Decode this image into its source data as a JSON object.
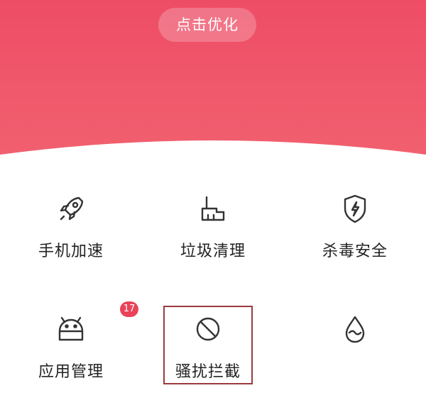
{
  "header": {
    "optimize_label": "点击优化",
    "color_top": "#ee4d66",
    "color_bottom": "#f1606f"
  },
  "tools": [
    {
      "label": "手机加速",
      "icon": "rocket-icon"
    },
    {
      "label": "垃圾清理",
      "icon": "broom-icon"
    },
    {
      "label": "杀毒安全",
      "icon": "shield-bolt-icon"
    },
    {
      "label": "应用管理",
      "icon": "android-robot-icon",
      "badge": "17"
    },
    {
      "label": "骚扰拦截",
      "icon": "block-icon",
      "highlighted": true
    },
    {
      "label": "",
      "icon": "water-drop-icon"
    }
  ],
  "colors": {
    "badge": "#e9435a",
    "icon_stroke": "#333333",
    "label_text": "#222222",
    "highlight_border": "#9c3a3f"
  }
}
